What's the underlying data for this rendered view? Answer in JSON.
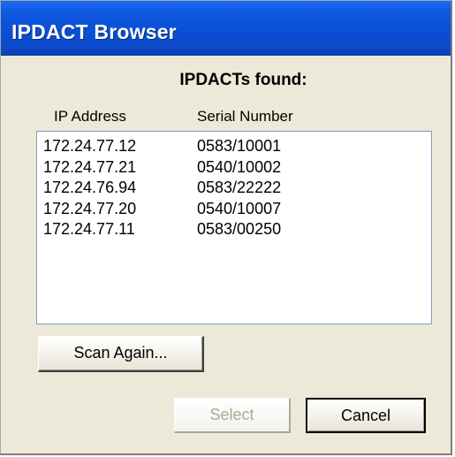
{
  "window": {
    "title": "IPDACT Browser"
  },
  "dialog": {
    "heading": "IPDACTs found:",
    "columns": {
      "ip": "IP Address",
      "serial": "Serial Number"
    },
    "rows": [
      {
        "ip": "172.24.77.12",
        "serial": "0583/10001"
      },
      {
        "ip": "172.24.77.21",
        "serial": "0540/10002"
      },
      {
        "ip": "172.24.76.94",
        "serial": "0583/22222"
      },
      {
        "ip": "172.24.77.20",
        "serial": "0540/10007"
      },
      {
        "ip": "172.24.77.11",
        "serial": "0583/00250"
      }
    ]
  },
  "buttons": {
    "scan_again": "Scan Again...",
    "select": "Select",
    "cancel": "Cancel"
  },
  "colors": {
    "titlebar": "#0a4fd6",
    "dialog_bg": "#ece9d8",
    "list_border": "#7f9db9",
    "disabled_text": "#aca899"
  }
}
